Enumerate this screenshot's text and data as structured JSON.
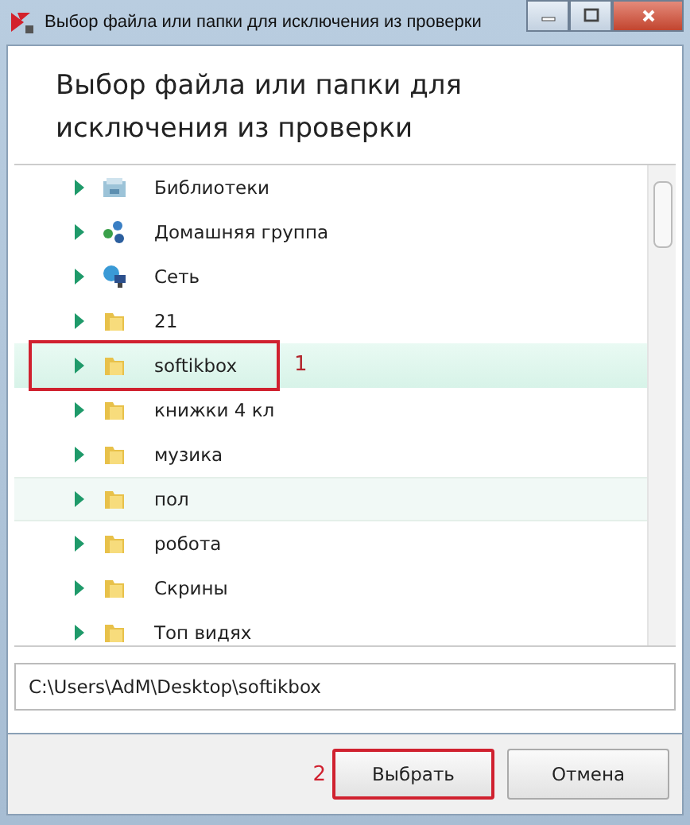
{
  "window": {
    "title": "Выбор файла или папки для исключения из проверки"
  },
  "heading": "Выбор файла или папки для исключения из проверки",
  "tree": [
    {
      "label": "Библиотеки",
      "kind": "library",
      "selected": false,
      "hovered": false
    },
    {
      "label": "Домашняя группа",
      "kind": "homegroup",
      "selected": false,
      "hovered": false
    },
    {
      "label": "Сеть",
      "kind": "network",
      "selected": false,
      "hovered": false
    },
    {
      "label": "21",
      "kind": "folder",
      "selected": false,
      "hovered": false
    },
    {
      "label": "softikbox",
      "kind": "folder",
      "selected": true,
      "hovered": false,
      "annotation": "1"
    },
    {
      "label": "книжки 4 кл",
      "kind": "folder",
      "selected": false,
      "hovered": false
    },
    {
      "label": "музика",
      "kind": "folder",
      "selected": false,
      "hovered": false
    },
    {
      "label": "пол",
      "kind": "folder",
      "selected": false,
      "hovered": true
    },
    {
      "label": "робота",
      "kind": "folder",
      "selected": false,
      "hovered": false
    },
    {
      "label": "Скрины",
      "kind": "folder",
      "selected": false,
      "hovered": false
    },
    {
      "label": "Топ видях",
      "kind": "folder",
      "selected": false,
      "hovered": false
    }
  ],
  "path": {
    "value": "C:\\Users\\AdM\\Desktop\\softikbox"
  },
  "buttons": [
    {
      "label": "Выбрать",
      "annotation": "2"
    },
    {
      "label": "Отмена"
    }
  ]
}
